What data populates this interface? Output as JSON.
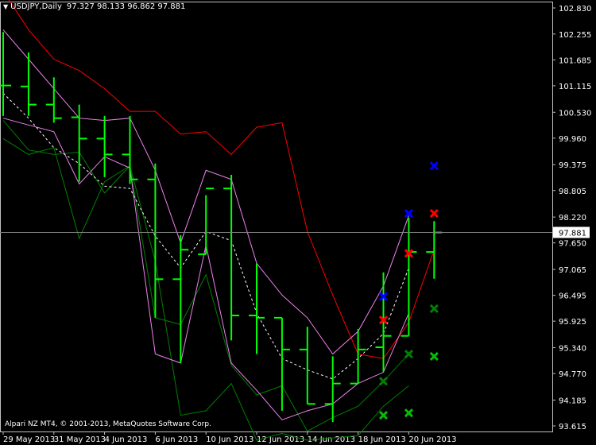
{
  "header": {
    "symbol_label": "USDJPY,Daily",
    "ohlc": "97.327 98.133 96.862 97.881"
  },
  "copyright": "Alpari NZ MT4, © 2001-2013, MetaQuotes Software Corp.",
  "current_price_label": "97.881",
  "colors": {
    "background": "#000000",
    "grid_axis": "#c0c0c0",
    "bars": "#00ff00",
    "red_line": "#ff0000",
    "envelope": "#ee82ee",
    "dashed_mid": "#ffffff",
    "green_lines": "#008000",
    "x_blue": "#0000ff",
    "x_red": "#ff0000",
    "x_darkgreen": "#008000",
    "x_lightgreen": "#00c000"
  },
  "chart_data": {
    "type": "ohlc",
    "title": "USDJPY,Daily",
    "y_ticks": [
      "102.830",
      "102.255",
      "101.685",
      "101.115",
      "100.530",
      "99.960",
      "99.375",
      "98.805",
      "98.220",
      "97.650",
      "97.065",
      "96.495",
      "95.925",
      "95.340",
      "94.770",
      "94.185",
      "93.615"
    ],
    "ylim": [
      93.615,
      102.83
    ],
    "x_tick_labels": [
      "29 May 2013",
      "31 May 2013",
      "4 Jun 2013",
      "6 Jun 2013",
      "10 Jun 2013",
      "12 Jun 2013",
      "14 Jun 2013",
      "18 Jun 2013",
      "20 Jun 2013"
    ],
    "x_tick_bar_index": [
      0,
      2,
      4,
      6,
      8,
      10,
      12,
      14,
      16
    ],
    "bars": [
      {
        "open": 101.12,
        "high": 102.3,
        "low": 100.45,
        "close": 101.12
      },
      {
        "open": 101.1,
        "high": 101.85,
        "low": 100.45,
        "close": 100.7
      },
      {
        "open": 100.7,
        "high": 101.3,
        "low": 100.3,
        "close": 100.4
      },
      {
        "open": 100.42,
        "high": 100.7,
        "low": 99.0,
        "close": 99.95
      },
      {
        "open": 99.95,
        "high": 100.45,
        "low": 99.1,
        "close": 99.6
      },
      {
        "open": 99.6,
        "high": 100.45,
        "low": 98.95,
        "close": 99.05
      },
      {
        "open": 99.05,
        "high": 99.4,
        "low": 96.0,
        "close": 96.85
      },
      {
        "open": 96.85,
        "high": 97.82,
        "low": 95.0,
        "close": 97.5
      },
      {
        "open": 97.4,
        "high": 98.7,
        "low": 97.4,
        "close": 98.85
      },
      {
        "open": 98.85,
        "high": 99.15,
        "low": 95.5,
        "close": 96.05
      },
      {
        "open": 96.05,
        "high": 97.2,
        "low": 95.2,
        "close": 96.0
      },
      {
        "open": 96.0,
        "high": 96.0,
        "low": 93.95,
        "close": 95.3
      },
      {
        "open": 95.3,
        "high": 95.8,
        "low": 94.1,
        "close": 94.1
      },
      {
        "open": 94.1,
        "high": 95.15,
        "low": 93.7,
        "close": 94.55
      },
      {
        "open": 94.55,
        "high": 95.75,
        "low": 94.55,
        "close": 95.3
      },
      {
        "open": 95.35,
        "high": 97.0,
        "low": 94.8,
        "close": 95.6
      },
      {
        "open": 95.6,
        "high": 98.2,
        "low": 95.6,
        "close": 97.45
      },
      {
        "open": 97.45,
        "high": 98.13,
        "low": 96.86,
        "close": 97.88
      }
    ],
    "red_line": [
      103.2,
      102.35,
      101.7,
      101.45,
      101.05,
      100.55,
      100.55,
      100.05,
      100.1,
      99.6,
      100.2,
      100.3,
      97.9,
      96.5,
      95.2,
      95.1,
      95.9,
      97.5
    ],
    "envelope_upper": [
      102.35,
      101.7,
      101.05,
      100.4,
      100.35,
      100.4,
      99.25,
      97.65,
      99.25,
      99.05,
      97.2,
      96.5,
      96.0,
      95.2,
      95.7,
      96.7,
      98.25
    ],
    "envelope_lower": [
      100.4,
      100.25,
      100.1,
      98.95,
      99.55,
      99.3,
      95.2,
      95.0,
      97.6,
      95.0,
      94.4,
      93.75,
      93.95,
      94.1,
      94.55,
      94.8,
      96.1
    ],
    "dashed_midline": [
      100.95,
      100.4,
      99.75,
      99.4,
      98.9,
      98.85,
      97.8,
      97.1,
      97.9,
      97.7,
      96.1,
      95.1,
      94.85,
      94.65,
      95.1,
      95.65,
      97.1
    ],
    "green_lines": [
      [
        100.35,
        99.7,
        99.6,
        99.65,
        98.75,
        99.35,
        96.0,
        95.85,
        96.95,
        94.95,
        94.3,
        94.5,
        93.5,
        93.8,
        94.05,
        94.6,
        95.2
      ],
      [
        99.95,
        99.6,
        99.75,
        97.75,
        99.0,
        99.35,
        97.25,
        93.85,
        93.95,
        94.55,
        93.3,
        93.45,
        93.3,
        93.35,
        93.4,
        94.05,
        94.5
      ]
    ],
    "markers": [
      {
        "bar": 15,
        "y": 96.47,
        "color": "x_blue"
      },
      {
        "bar": 16,
        "y": 98.3,
        "color": "x_blue"
      },
      {
        "bar": 17,
        "y": 99.35,
        "color": "x_blue"
      },
      {
        "bar": 15,
        "y": 95.95,
        "color": "x_red"
      },
      {
        "bar": 16,
        "y": 97.42,
        "color": "x_red"
      },
      {
        "bar": 17,
        "y": 98.3,
        "color": "x_red"
      },
      {
        "bar": 15,
        "y": 94.6,
        "color": "x_darkgreen"
      },
      {
        "bar": 16,
        "y": 95.2,
        "color": "x_darkgreen"
      },
      {
        "bar": 17,
        "y": 96.2,
        "color": "x_darkgreen"
      },
      {
        "bar": 15,
        "y": 93.85,
        "color": "x_lightgreen"
      },
      {
        "bar": 16,
        "y": 93.9,
        "color": "x_lightgreen"
      },
      {
        "bar": 17,
        "y": 95.15,
        "color": "x_lightgreen"
      }
    ]
  }
}
